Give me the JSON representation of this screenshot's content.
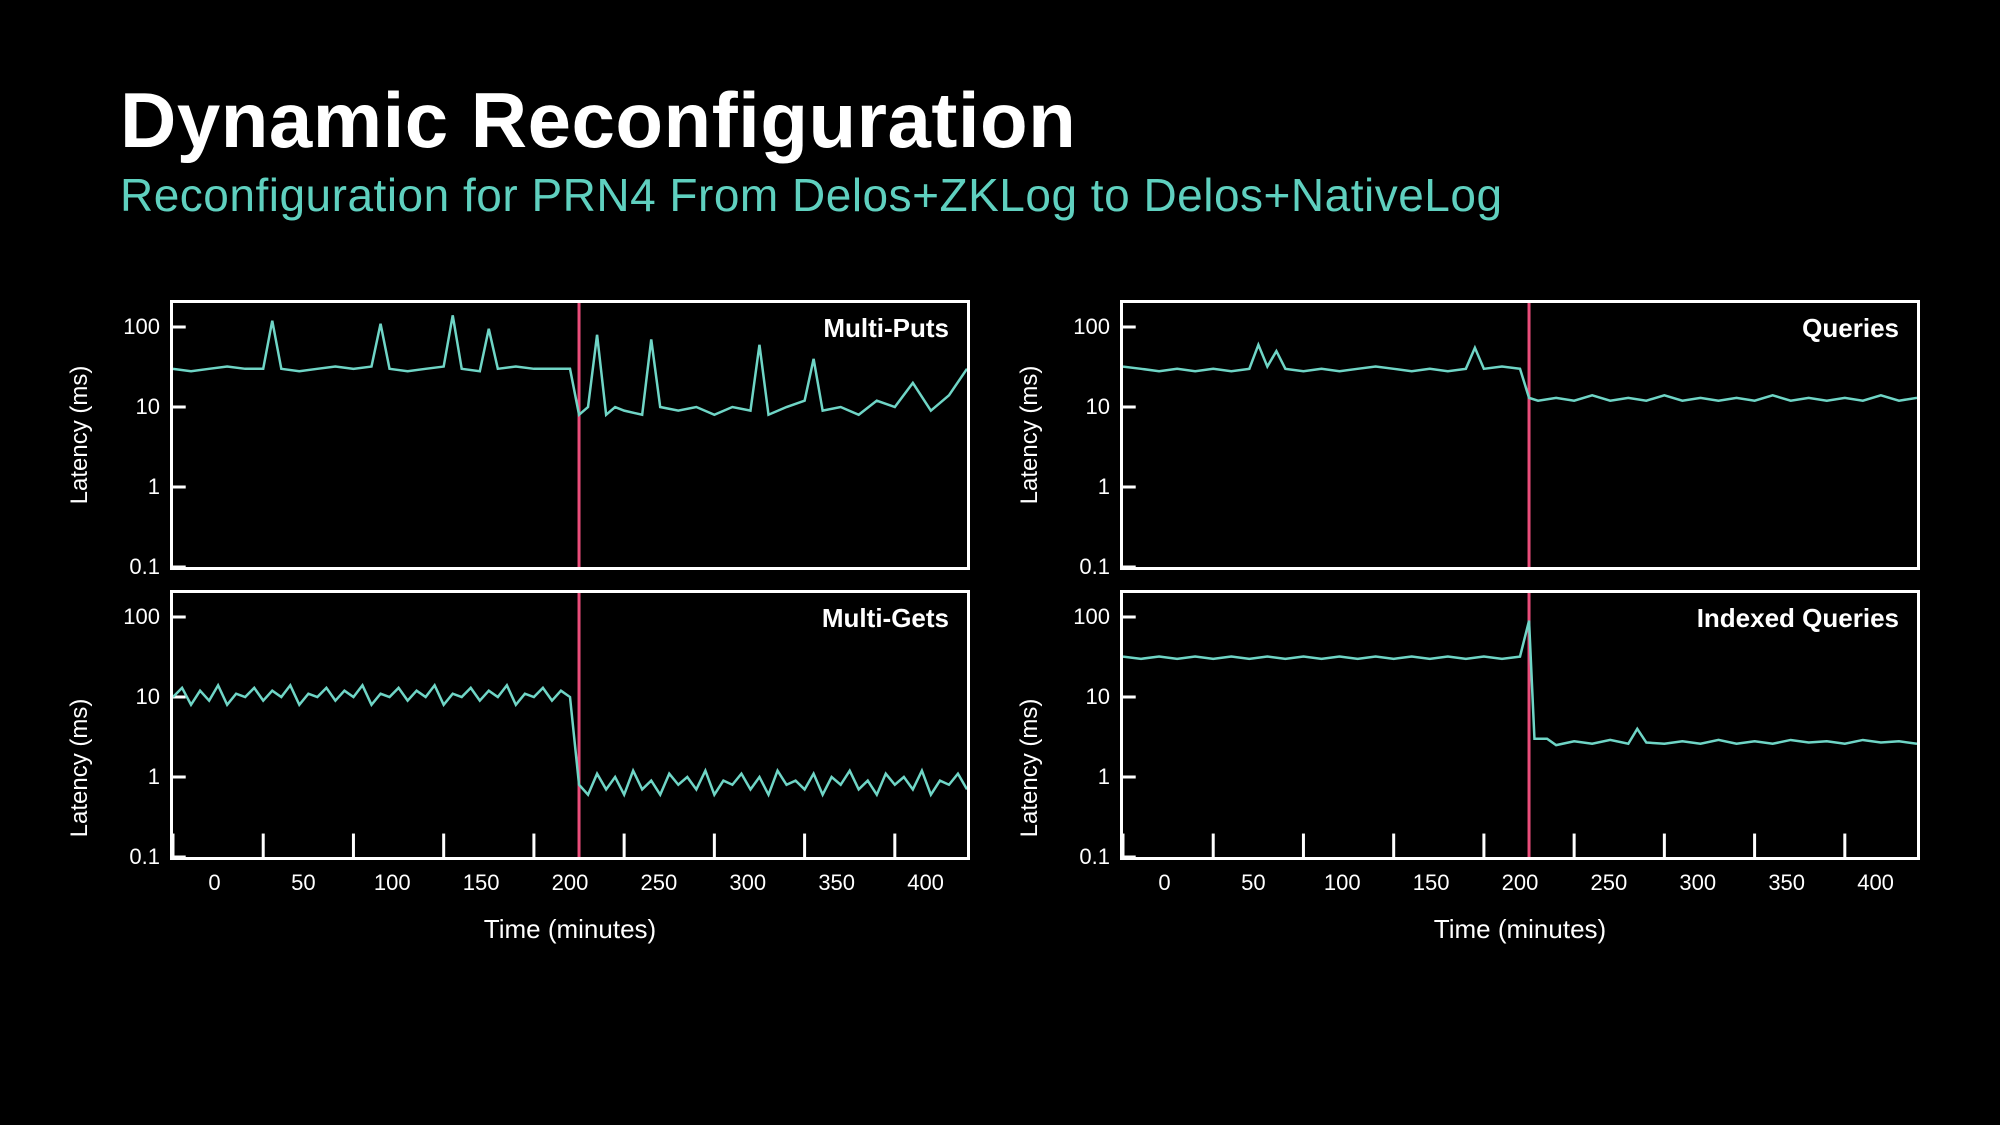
{
  "title": "Dynamic Reconfiguration",
  "subtitle": "Reconfiguration for PRN4 From Delos+ZKLog to Delos+NativeLog",
  "axes": {
    "xlabel": "Time (minutes)",
    "ylabel": "Latency (ms)",
    "xticks": [
      0,
      50,
      100,
      150,
      200,
      250,
      300,
      350,
      400
    ],
    "yticks": [
      0.1,
      1,
      10,
      100
    ],
    "xlim": [
      0,
      440
    ],
    "ylim_log10": [
      -1,
      2.3
    ]
  },
  "event_x": 225,
  "charts": [
    {
      "key": "multi_puts",
      "title": "Multi-Puts",
      "row": "top",
      "col": "left"
    },
    {
      "key": "queries",
      "title": "Queries",
      "row": "top",
      "col": "right"
    },
    {
      "key": "multi_gets",
      "title": "Multi-Gets",
      "row": "bottom",
      "col": "left"
    },
    {
      "key": "indexed_queries",
      "title": "Indexed Queries",
      "row": "bottom",
      "col": "right"
    }
  ],
  "chart_data": [
    {
      "type": "line",
      "key": "multi_puts",
      "title": "Multi-Puts",
      "xlabel": "Time (minutes)",
      "ylabel": "Latency (ms)",
      "xlim": [
        0,
        440
      ],
      "ylim": [
        0.1,
        200
      ],
      "yscale": "log",
      "event_x": 225,
      "series": [
        {
          "name": "latency",
          "x": [
            0,
            10,
            20,
            30,
            40,
            50,
            55,
            60,
            70,
            80,
            90,
            100,
            110,
            115,
            120,
            130,
            140,
            150,
            155,
            160,
            170,
            175,
            180,
            190,
            200,
            210,
            220,
            225,
            230,
            235,
            240,
            245,
            250,
            260,
            265,
            270,
            280,
            290,
            300,
            310,
            320,
            325,
            330,
            340,
            350,
            355,
            360,
            370,
            380,
            390,
            400,
            410,
            420,
            430,
            440
          ],
          "values": [
            30,
            28,
            30,
            32,
            30,
            30,
            120,
            30,
            28,
            30,
            32,
            30,
            32,
            110,
            30,
            28,
            30,
            32,
            140,
            30,
            28,
            95,
            30,
            32,
            30,
            30,
            30,
            8,
            10,
            80,
            8,
            10,
            9,
            8,
            70,
            10,
            9,
            10,
            8,
            10,
            9,
            60,
            8,
            10,
            12,
            40,
            9,
            10,
            8,
            12,
            10,
            20,
            9,
            14,
            30
          ]
        }
      ]
    },
    {
      "type": "line",
      "key": "queries",
      "title": "Queries",
      "xlabel": "Time (minutes)",
      "ylabel": "Latency (ms)",
      "xlim": [
        0,
        440
      ],
      "ylim": [
        0.1,
        200
      ],
      "yscale": "log",
      "event_x": 225,
      "series": [
        {
          "name": "latency",
          "x": [
            0,
            10,
            20,
            30,
            40,
            50,
            60,
            70,
            75,
            80,
            85,
            90,
            100,
            110,
            120,
            130,
            140,
            150,
            160,
            170,
            180,
            190,
            195,
            200,
            210,
            220,
            225,
            230,
            240,
            250,
            260,
            270,
            280,
            290,
            300,
            310,
            320,
            330,
            340,
            350,
            360,
            370,
            380,
            390,
            400,
            410,
            420,
            430,
            440
          ],
          "values": [
            32,
            30,
            28,
            30,
            28,
            30,
            28,
            30,
            60,
            32,
            50,
            30,
            28,
            30,
            28,
            30,
            32,
            30,
            28,
            30,
            28,
            30,
            55,
            30,
            32,
            30,
            13,
            12,
            13,
            12,
            14,
            12,
            13,
            12,
            14,
            12,
            13,
            12,
            13,
            12,
            14,
            12,
            13,
            12,
            13,
            12,
            14,
            12,
            13
          ]
        }
      ]
    },
    {
      "type": "line",
      "key": "multi_gets",
      "title": "Multi-Gets",
      "xlabel": "Time (minutes)",
      "ylabel": "Latency (ms)",
      "xlim": [
        0,
        440
      ],
      "ylim": [
        0.1,
        200
      ],
      "yscale": "log",
      "event_x": 225,
      "series": [
        {
          "name": "latency",
          "x": [
            0,
            5,
            10,
            15,
            20,
            25,
            30,
            35,
            40,
            45,
            50,
            55,
            60,
            65,
            70,
            75,
            80,
            85,
            90,
            95,
            100,
            105,
            110,
            115,
            120,
            125,
            130,
            135,
            140,
            145,
            150,
            155,
            160,
            165,
            170,
            175,
            180,
            185,
            190,
            195,
            200,
            205,
            210,
            215,
            220,
            225,
            230,
            235,
            240,
            245,
            250,
            255,
            260,
            265,
            270,
            275,
            280,
            285,
            290,
            295,
            300,
            305,
            310,
            315,
            320,
            325,
            330,
            335,
            340,
            345,
            350,
            355,
            360,
            365,
            370,
            375,
            380,
            385,
            390,
            395,
            400,
            405,
            410,
            415,
            420,
            425,
            430,
            435,
            440
          ],
          "values": [
            10,
            13,
            8,
            12,
            9,
            14,
            8,
            11,
            10,
            13,
            9,
            12,
            10,
            14,
            8,
            11,
            10,
            13,
            9,
            12,
            10,
            14,
            8,
            11,
            10,
            13,
            9,
            12,
            10,
            14,
            8,
            11,
            10,
            13,
            9,
            12,
            10,
            14,
            8,
            11,
            10,
            13,
            9,
            12,
            10,
            0.8,
            0.6,
            1.1,
            0.7,
            1.0,
            0.6,
            1.2,
            0.7,
            0.9,
            0.6,
            1.1,
            0.8,
            1.0,
            0.7,
            1.2,
            0.6,
            0.9,
            0.8,
            1.1,
            0.7,
            1.0,
            0.6,
            1.2,
            0.8,
            0.9,
            0.7,
            1.1,
            0.6,
            1.0,
            0.8,
            1.2,
            0.7,
            0.9,
            0.6,
            1.1,
            0.8,
            1.0,
            0.7,
            1.2,
            0.6,
            0.9,
            0.8,
            1.1,
            0.7
          ]
        }
      ]
    },
    {
      "type": "line",
      "key": "indexed_queries",
      "title": "Indexed Queries",
      "xlabel": "Time (minutes)",
      "ylabel": "Latency (ms)",
      "xlim": [
        0,
        440
      ],
      "ylim": [
        0.1,
        200
      ],
      "yscale": "log",
      "event_x": 225,
      "series": [
        {
          "name": "latency",
          "x": [
            0,
            10,
            20,
            30,
            40,
            50,
            60,
            70,
            80,
            90,
            100,
            110,
            120,
            130,
            140,
            150,
            160,
            170,
            180,
            190,
            200,
            210,
            220,
            225,
            228,
            235,
            240,
            250,
            260,
            270,
            280,
            285,
            290,
            300,
            310,
            320,
            330,
            340,
            350,
            360,
            370,
            380,
            390,
            400,
            410,
            420,
            430,
            440
          ],
          "values": [
            32,
            30,
            32,
            30,
            32,
            30,
            32,
            30,
            32,
            30,
            32,
            30,
            32,
            30,
            32,
            30,
            32,
            30,
            32,
            30,
            32,
            30,
            32,
            90,
            3,
            3,
            2.5,
            2.8,
            2.6,
            2.9,
            2.6,
            4,
            2.7,
            2.6,
            2.8,
            2.6,
            2.9,
            2.6,
            2.8,
            2.6,
            2.9,
            2.7,
            2.8,
            2.6,
            2.9,
            2.7,
            2.8,
            2.6
          ]
        }
      ]
    }
  ]
}
